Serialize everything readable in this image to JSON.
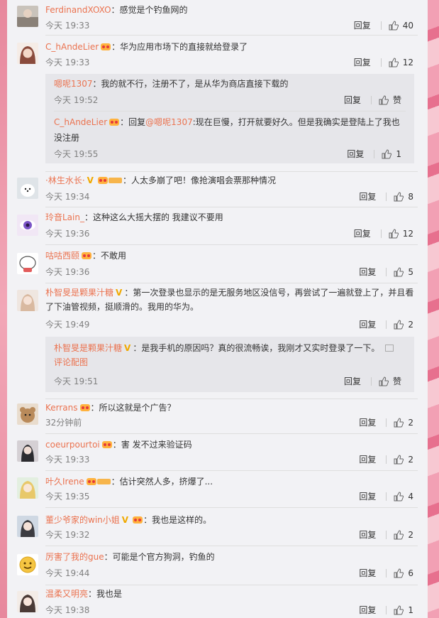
{
  "colors": {
    "username": "#eb7350",
    "text": "#333333",
    "meta": "#808080",
    "panel": "#f2f2f5",
    "subpanel": "#e6e6ea"
  },
  "labels": {
    "reply": "回复",
    "like_zero": "赞",
    "reply_prefix": "回复",
    "view_pic": "评论配图"
  },
  "comments": [
    {
      "user": "FerdinandXOXO",
      "text": "：感觉是个钓鱼网的",
      "time": "今天 19:33",
      "likes": "40"
    },
    {
      "user": "C_hAndeLier",
      "text": "：华为应用市场下的直接就给登录了",
      "time": "今天 19:33",
      "likes": "12",
      "replies": [
        {
          "user": "嗯呢1307",
          "text": "：我的就不行，注册不了，是从华为商店直接下载的",
          "time": "今天 19:52",
          "likes": "赞"
        },
        {
          "user": "C_hAndeLier",
          "at": "@嗯呢1307",
          "text": ":现在巨慢，打开就要好久。但是我确实是登陆上了我也没注册",
          "time": "今天 19:55",
          "likes": "1"
        }
      ]
    },
    {
      "user": "·林生水长·",
      "text": "：人太多崩了吧！像抢演唱会票那种情况",
      "time": "今天 19:34",
      "likes": "8"
    },
    {
      "user": "玲音Lain_",
      "text": "：这种这么大摇大摆的 我建议不要用",
      "time": "今天 19:36",
      "likes": "12"
    },
    {
      "user": "咕咕西颐",
      "text": "：不敢用",
      "time": "今天 19:36",
      "likes": "5"
    },
    {
      "user": "朴智旻是颗果汁糖",
      "text": "：第一次登录也显示的是无服务地区没信号，再尝试了一遍就登上了，并且看了下油管视频，挺顺滑的。我用的华为。",
      "time": "今天 19:49",
      "likes": "2",
      "replies": [
        {
          "user": "朴智旻是颗果汁糖",
          "text": "：是我手机的原因吗？真的很流畅诶，我刚才又实时登录了一下。",
          "time": "今天 19:51",
          "likes": "赞"
        }
      ]
    },
    {
      "user": "Kerrans",
      "text": "：所以这就是个广告？",
      "time": "32分钟前",
      "likes": "2"
    },
    {
      "user": "coeurpourtoi",
      "text": "：害 发不过来验证码",
      "time": "今天 19:33",
      "likes": "2"
    },
    {
      "user": "叶久Irene",
      "text": "：估计突然人多，挤爆了...",
      "time": "今天 19:35",
      "likes": "4"
    },
    {
      "user": "董少爷家的win小姐",
      "text": "：我也是这样的。",
      "time": "今天 19:32",
      "likes": "2"
    },
    {
      "user": "厉害了我的gue",
      "text": "：可能是个官方狗洞，钓鱼的",
      "time": "今天 19:44",
      "likes": "6"
    },
    {
      "user": "温柔又明亮",
      "text": "：我也是",
      "time": "今天 19:38",
      "likes": "1"
    }
  ]
}
